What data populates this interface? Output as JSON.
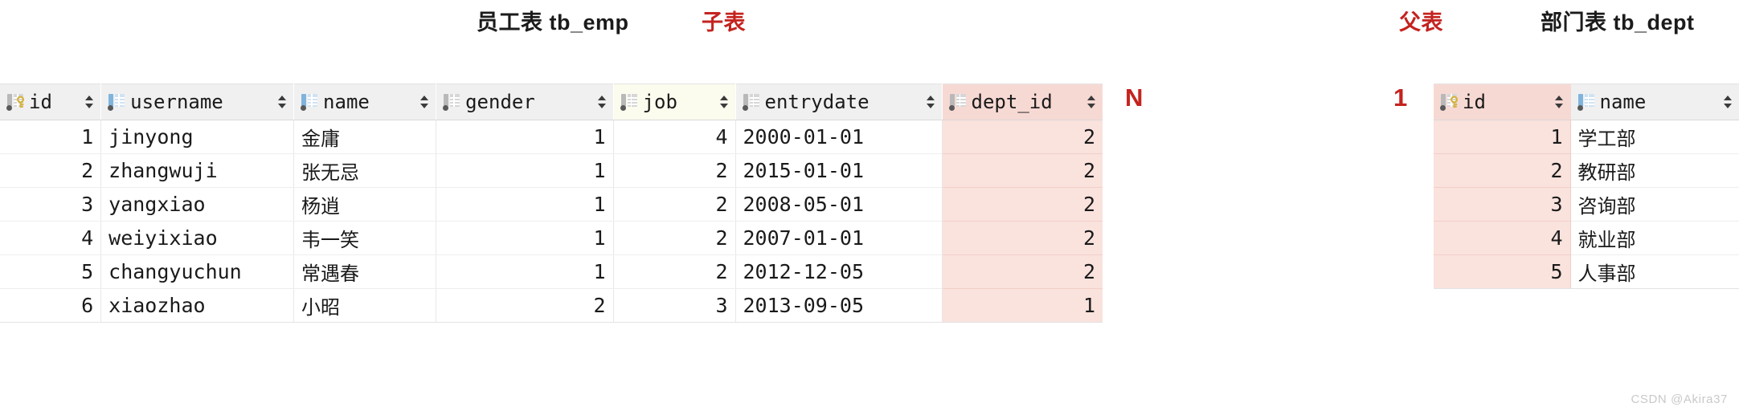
{
  "colors": {
    "accent_red": "#c4231f",
    "highlight_pink": "#f7d9d4",
    "highlight_pink_cell": "#fae2dd",
    "header_grey": "#f0f0f0",
    "header_cream": "#fbfbee",
    "key_gold": "#d6b13c",
    "type_blue": "#7fb4dd",
    "watermark_grey": "#c9c9c9"
  },
  "emp": {
    "title": "员工表 tb_emp",
    "role_label": "子表",
    "cardinality": "N",
    "columns": [
      {
        "name": "id",
        "icon": "primary-key-column-icon",
        "align": "num",
        "highlight": false,
        "cream": false
      },
      {
        "name": "username",
        "icon": "varchar-column-icon",
        "align": "txt",
        "highlight": false,
        "cream": false
      },
      {
        "name": "name",
        "icon": "varchar-column-icon",
        "align": "cjk",
        "highlight": false,
        "cream": false
      },
      {
        "name": "gender",
        "icon": "numeric-column-icon",
        "align": "num",
        "highlight": false,
        "cream": false
      },
      {
        "name": "job",
        "icon": "numeric-column-icon",
        "align": "num",
        "highlight": false,
        "cream": true
      },
      {
        "name": "entrydate",
        "icon": "date-column-icon",
        "align": "txt",
        "highlight": false,
        "cream": false
      },
      {
        "name": "dept_id",
        "icon": "foreign-key-column-icon",
        "align": "num",
        "highlight": true,
        "cream": false
      }
    ],
    "rows": [
      {
        "id": "1",
        "username": "jinyong",
        "name": "金庸",
        "gender": "1",
        "job": "4",
        "entrydate": "2000-01-01",
        "dept_id": "2"
      },
      {
        "id": "2",
        "username": "zhangwuji",
        "name": "张无忌",
        "gender": "1",
        "job": "2",
        "entrydate": "2015-01-01",
        "dept_id": "2"
      },
      {
        "id": "3",
        "username": "yangxiao",
        "name": "杨逍",
        "gender": "1",
        "job": "2",
        "entrydate": "2008-05-01",
        "dept_id": "2"
      },
      {
        "id": "4",
        "username": "weiyixiao",
        "name": "韦一笑",
        "gender": "1",
        "job": "2",
        "entrydate": "2007-01-01",
        "dept_id": "2"
      },
      {
        "id": "5",
        "username": "changyuchun",
        "name": "常遇春",
        "gender": "1",
        "job": "2",
        "entrydate": "2012-12-05",
        "dept_id": "2"
      },
      {
        "id": "6",
        "username": "xiaozhao",
        "name": "小昭",
        "gender": "2",
        "job": "3",
        "entrydate": "2013-09-05",
        "dept_id": "1"
      }
    ]
  },
  "dept": {
    "title": "部门表 tb_dept",
    "role_label": "父表",
    "cardinality": "1",
    "columns": [
      {
        "name": "id",
        "icon": "primary-key-column-icon",
        "align": "num",
        "highlight": true,
        "cream": false
      },
      {
        "name": "name",
        "icon": "varchar-column-icon",
        "align": "cjk",
        "highlight": false,
        "cream": false
      }
    ],
    "rows": [
      {
        "id": "1",
        "name": "学工部"
      },
      {
        "id": "2",
        "name": "教研部"
      },
      {
        "id": "3",
        "name": "咨询部"
      },
      {
        "id": "4",
        "name": "就业部"
      },
      {
        "id": "5",
        "name": "人事部"
      }
    ]
  },
  "watermark": "CSDN @Akira37"
}
